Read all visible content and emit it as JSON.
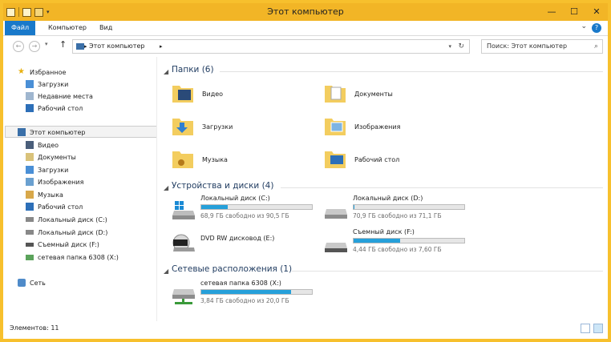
{
  "window": {
    "title": "Этот компьютер"
  },
  "ribbon": {
    "tabs": [
      "Файл",
      "Компьютер",
      "Вид"
    ]
  },
  "address": {
    "path": "Этот компьютер",
    "search_placeholder": "Поиск: Этот компьютер"
  },
  "nav": {
    "favorites": "Избранное",
    "fav_items": [
      "Загрузки",
      "Недавние места",
      "Рабочий стол"
    ],
    "computer": "Этот компьютер",
    "pc_items": [
      "Видео",
      "Документы",
      "Загрузки",
      "Изображения",
      "Музыка",
      "Рабочий стол",
      "Локальный диск (C:)",
      "Локальный диск (D:)",
      "Съемный диск (F:)",
      "сетевая папка 6308 (X:)"
    ],
    "network": "Сеть"
  },
  "content": {
    "folders_header": "Папки (6)",
    "folders": [
      "Видео",
      "Документы",
      "Загрузки",
      "Изображения",
      "Музыка",
      "Рабочий стол"
    ],
    "devices_header": "Устройства и диски (4)",
    "drives": [
      {
        "name": "Локальный диск (C:)",
        "free": "68,9 ГБ свободно из 90,5 ГБ",
        "used_fraction": 0.24
      },
      {
        "name": "Локальный диск (D:)",
        "free": "70,9 ГБ свободно из 71,1 ГБ",
        "used_fraction": 0.01
      },
      {
        "name": "DVD RW дисковод (E:)"
      },
      {
        "name": "Съемный диск (F:)",
        "free": "4,44 ГБ свободно из 7,60 ГБ",
        "used_fraction": 0.42
      }
    ],
    "network_header": "Сетевые расположения (1)",
    "network_drive": {
      "name": "сетевая папка 6308 (X:)",
      "free": "3,84 ГБ свободно из 20,0 ГБ",
      "used_fraction": 0.81
    }
  },
  "status": {
    "count": "Элементов: 11"
  },
  "colors": {
    "accent": "#1979ca",
    "titlebar": "#f2b526",
    "bar_fill": "#26a0da"
  },
  "icons": {
    "folder": "folder-icon",
    "drive": "hard-drive-icon",
    "dvd": "dvd-drive-icon",
    "usb": "removable-drive-icon",
    "network": "network-drive-icon"
  }
}
